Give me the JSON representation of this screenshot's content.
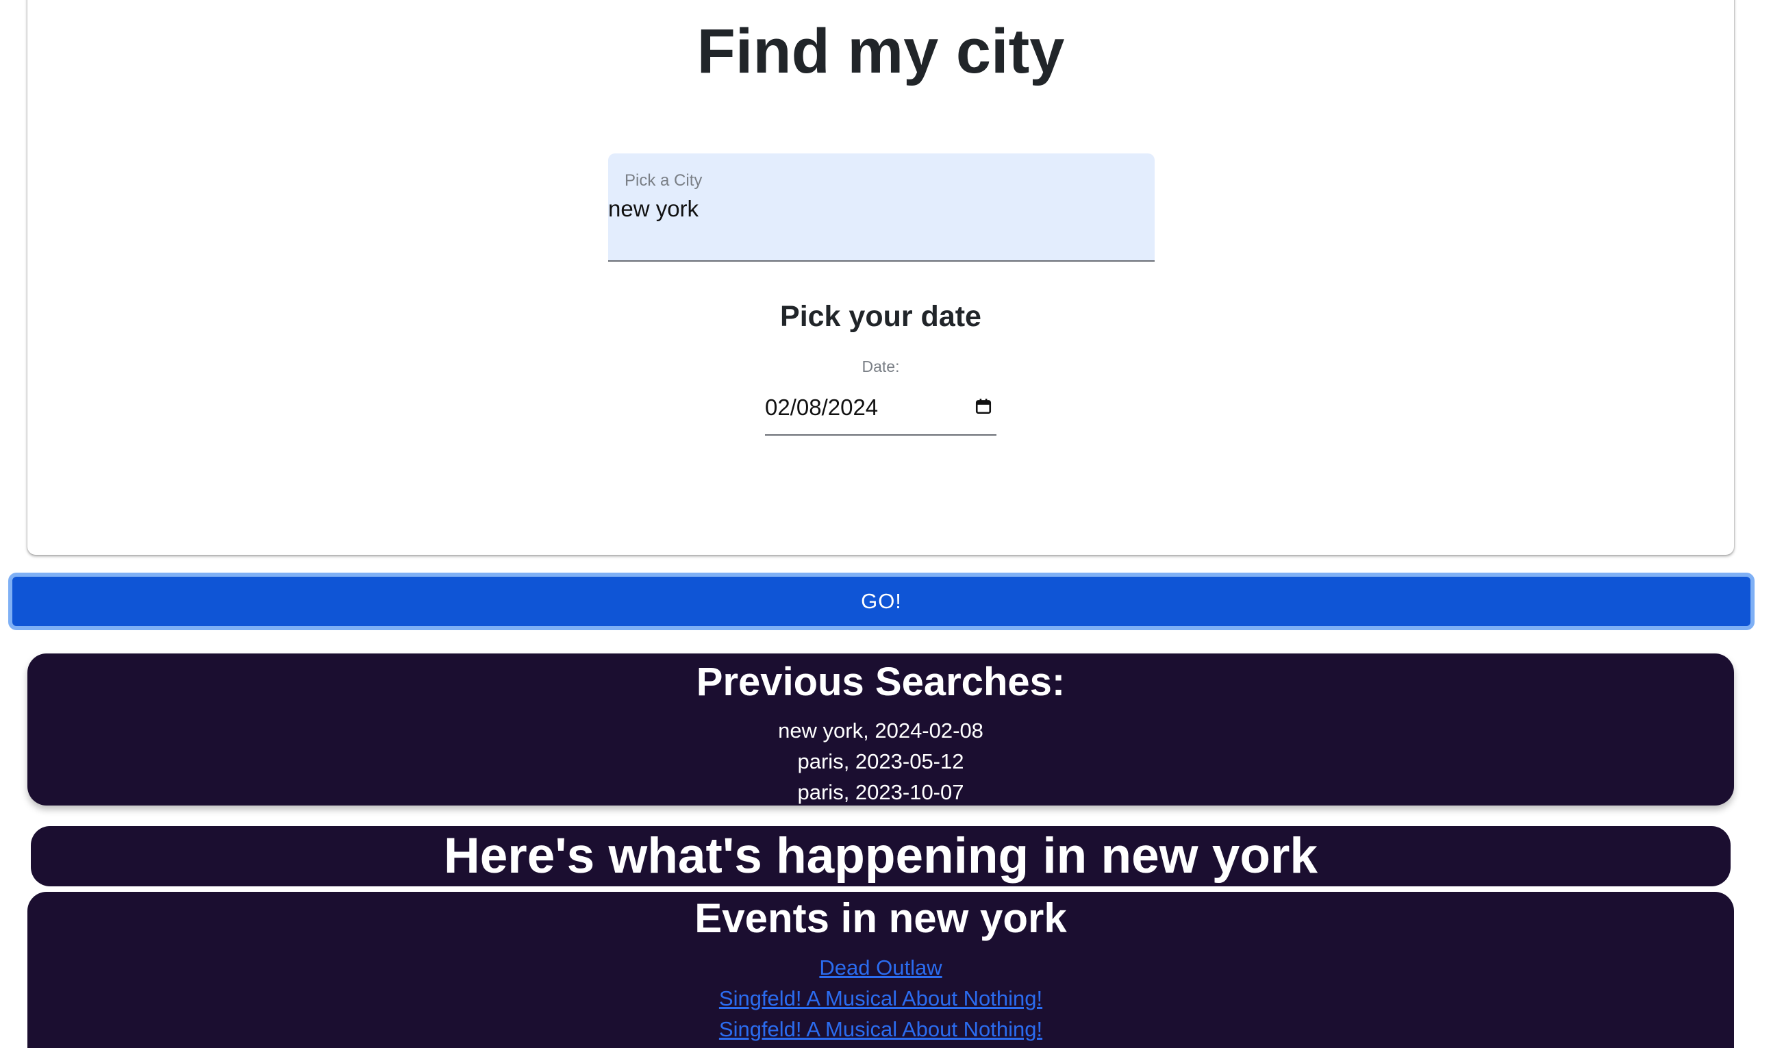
{
  "header": {
    "title": "Find my city"
  },
  "city_field": {
    "label": "Pick a City",
    "value": "new york"
  },
  "date_section": {
    "heading": "Pick your date",
    "label": "Date:",
    "value": "02/08/2024",
    "icon": "calendar-icon"
  },
  "go_button": {
    "label": "GO!",
    "color": "#0f55d6"
  },
  "previous_searches": {
    "title": "Previous Searches:",
    "items": [
      "new york, 2024-02-08",
      "paris, 2023-05-12",
      "paris, 2023-10-07"
    ]
  },
  "happening": {
    "title": "Here's what's happening in new york"
  },
  "events": {
    "title": "Events in new york",
    "items": [
      "Dead Outlaw",
      "Singfeld! A Musical About Nothing!",
      "Singfeld! A Musical About Nothing!"
    ]
  },
  "colors": {
    "dark_card": "#1b0e30",
    "link": "#2b6cf0",
    "city_field_bg": "#e3edfd"
  }
}
